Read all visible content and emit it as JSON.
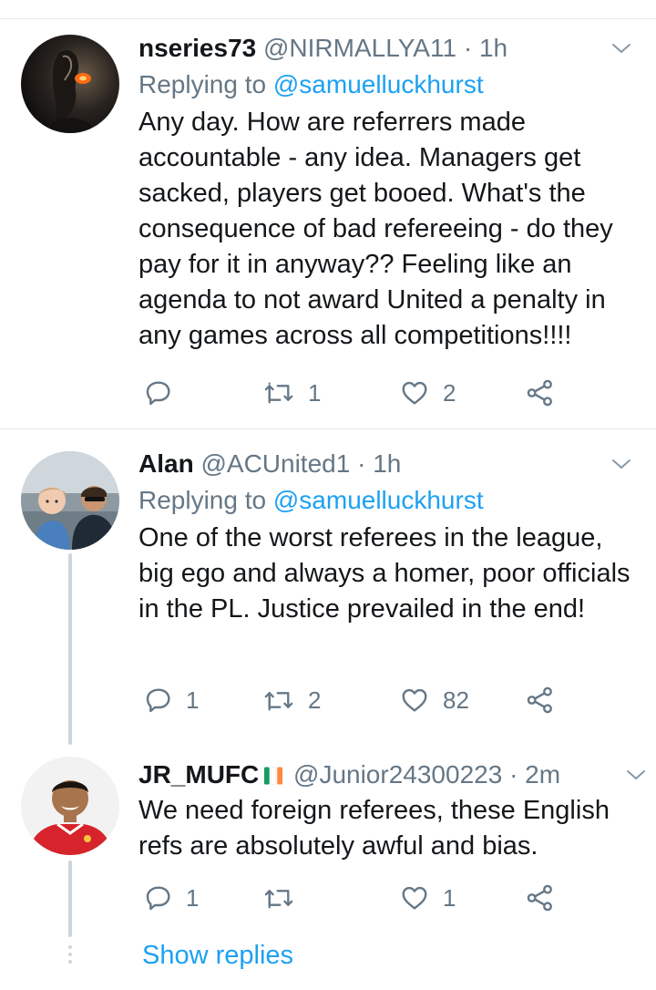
{
  "tweets": [
    {
      "name": "nseries73",
      "handle": "@NIRMALLYA11",
      "separator": "·",
      "time": "1h",
      "replying_prefix": "Replying to",
      "replying_to": "@samuelluckhurst",
      "text": "Any day. How are referrers made accountable - any idea. Managers get sacked, players get booed. What's the consequence of bad refereeing - do they pay for it in anyway?? Feeling like an agenda to not award United a penalty in any games across all competitions!!!!",
      "replies": "",
      "retweets": "1",
      "likes": "2"
    },
    {
      "name": "Alan",
      "handle": "@ACUnited1",
      "separator": "·",
      "time": "1h",
      "replying_prefix": "Replying to",
      "replying_to": "@samuelluckhurst",
      "text": "One of the worst referees in the league, big ego and always a homer, poor officials in the PL. Justice prevailed in the end!",
      "replies": "1",
      "retweets": "2",
      "likes": "82"
    },
    {
      "name": "JR_MUFC",
      "flag": "ireland-flag-icon",
      "handle": "@Junior24300223",
      "separator": "·",
      "time": "2m",
      "text": "We need foreign referees, these English refs are absolutely awful and bias.",
      "replies": "1",
      "retweets": "",
      "likes": "1"
    }
  ],
  "show_replies": "Show replies",
  "colors": {
    "link": "#1da1f2",
    "muted": "#657786",
    "text": "#14171a",
    "divider": "#e1e8ed",
    "thread_line": "#ccd6dd"
  },
  "icons": {
    "reply": "reply-icon",
    "retweet": "retweet-icon",
    "like": "heart-icon",
    "share": "share-icon",
    "more": "chevron-down-icon"
  }
}
